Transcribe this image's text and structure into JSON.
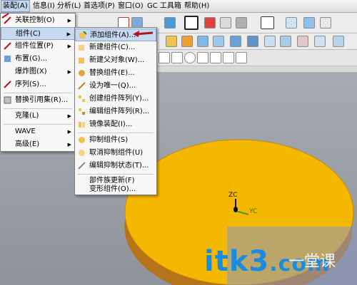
{
  "menubar": {
    "items": [
      "装配(A)",
      "信息(I)",
      "分析(L)",
      "首选项(P)",
      "窗口(O)",
      "GC 工具箱",
      "帮助(H)"
    ]
  },
  "assembly_menu": {
    "items": [
      {
        "label": "关联控制(O)",
        "submenu": true
      },
      {
        "label": "组件(C)",
        "submenu": true,
        "highlighted": true
      },
      {
        "label": "组件位置(P)",
        "submenu": true
      },
      {
        "label": "布置(G)...",
        "submenu": false
      },
      {
        "label": "爆炸图(X)",
        "submenu": true
      },
      {
        "label": "序列(S)...",
        "submenu": false
      },
      {
        "label": "替换引用集(R)...",
        "submenu": false
      },
      {
        "label": "克隆(L)",
        "submenu": true
      },
      {
        "label": "WAVE",
        "submenu": true
      },
      {
        "label": "高级(E)",
        "submenu": true
      }
    ]
  },
  "component_submenu": {
    "items": [
      {
        "label": "添加组件(A)...",
        "highlighted": true
      },
      {
        "label": "新建组件(C)..."
      },
      {
        "label": "新建父对象(W)..."
      },
      {
        "label": "替换组件(E)..."
      },
      {
        "label": "设为唯一(Q)..."
      },
      {
        "label": "创建组件阵列(Y)..."
      },
      {
        "label": "编辑组件阵列(R)..."
      },
      {
        "label": "镜像装配(I)..."
      },
      {
        "label": "抑制组件(S)"
      },
      {
        "label": "取消抑制组件(U)"
      },
      {
        "label": "编辑抑制状态(T)..."
      },
      {
        "label": "部件族更新(F)"
      },
      {
        "label": "变形组件(O)..."
      }
    ]
  },
  "viewport": {
    "axis_z": "ZC",
    "axis_y": "YC",
    "disk_color": "#f5b800",
    "disk_edge_color": "#b5731a"
  },
  "watermark": {
    "text": "itk3",
    "suffix": ".com",
    "cn": "一堂课"
  },
  "colors": {
    "accent": "#c6d9f0",
    "arrow": "#b01522"
  }
}
